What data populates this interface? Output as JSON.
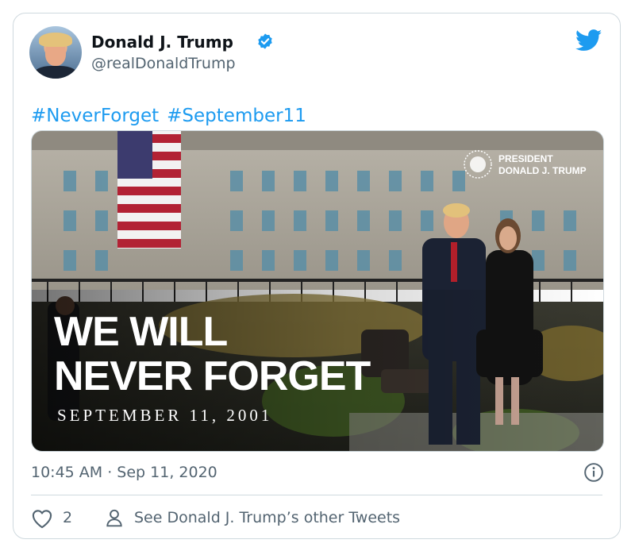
{
  "tweet": {
    "author_name": "Donald J. Trump",
    "author_handle": "@realDonaldTrump",
    "verified": true,
    "hashtags": [
      "#NeverForget",
      "#September11"
    ],
    "timestamp": "10:45 AM · Sep 11, 2020",
    "like_count": "2",
    "other_tweets_label": "See Donald J. Trump’s other Tweets"
  },
  "media": {
    "headline_line1": "WE WILL",
    "headline_line2": "NEVER FORGET",
    "date_line": "SEPTEMBER 11, 2001",
    "seal_line1": "PRESIDENT",
    "seal_line2": "DONALD J. TRUMP"
  },
  "icons": {
    "verified": "verified-badge-icon",
    "brand": "twitter-bird-icon",
    "info": "info-icon",
    "like": "heart-icon",
    "profile": "person-icon"
  },
  "colors": {
    "link": "#1d9bf0",
    "secondary_text": "#536471",
    "border": "#cfd9de"
  }
}
